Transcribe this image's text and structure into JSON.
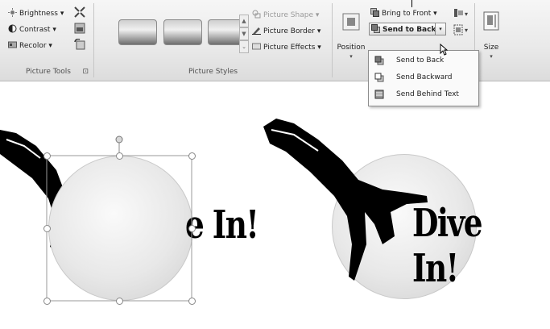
{
  "ribbon": {
    "picture_tools": {
      "label": "Picture Tools",
      "brightness": "Brightness",
      "contrast": "Contrast",
      "recolor": "Recolor",
      "launcher": "⊡"
    },
    "picture_styles": {
      "label": "Picture Styles",
      "picture_shape": "Picture Shape",
      "picture_border": "Picture Border",
      "picture_effects": "Picture Effects"
    },
    "arrange": {
      "position": "Position",
      "bring_to_front": "Bring to Front",
      "send_to_back": "Send to Back"
    },
    "size": {
      "label": "Size"
    }
  },
  "send_menu": {
    "items": [
      {
        "label": "Send to Back"
      },
      {
        "label": "Send Backward"
      },
      {
        "label": "Send Behind Text"
      }
    ]
  },
  "canvas": {
    "left_text": "e In!",
    "right_text": "Dive In!"
  },
  "colors": {
    "ribbon_bg": "#e9e9e9",
    "menu_bg": "#fafafa",
    "text": "#222222"
  }
}
